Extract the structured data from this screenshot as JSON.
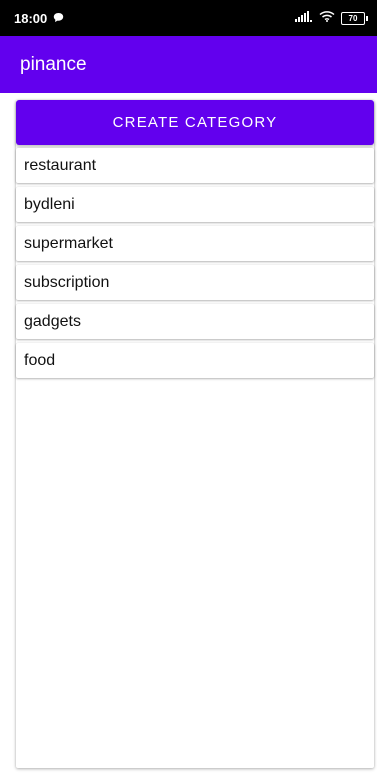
{
  "status_bar": {
    "time": "18:00",
    "battery": "70",
    "icons": [
      "chat-bubble-icon",
      "signal-icon",
      "wifi-icon",
      "battery-icon"
    ]
  },
  "app_bar": {
    "title": "pinance"
  },
  "create_button": {
    "label": "CREATE CATEGORY"
  },
  "categories": [
    {
      "label": "restaurant"
    },
    {
      "label": "bydleni"
    },
    {
      "label": "supermarket"
    },
    {
      "label": "subscription"
    },
    {
      "label": "gadgets"
    },
    {
      "label": "food"
    }
  ],
  "colors": {
    "primary": "#6200ee",
    "status_bar": "#000000",
    "surface": "#ffffff"
  }
}
